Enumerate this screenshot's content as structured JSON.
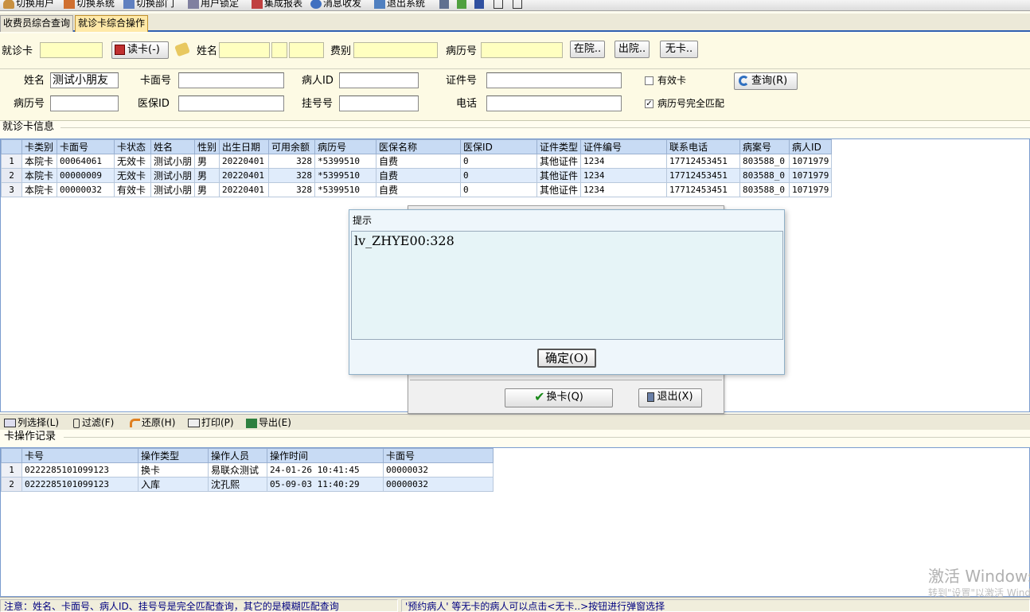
{
  "toolbar": {
    "items": [
      "切换用户",
      "切换系统",
      "切换部门",
      "用户锁定",
      "集成报表",
      "消息收发",
      "退出系统"
    ]
  },
  "tabs": [
    "收费员综合查询",
    "就诊卡综合操作"
  ],
  "top_form": {
    "card_label": "就诊卡",
    "read_card_button": "读卡(-)",
    "name_label": "姓名",
    "fee_type_label": "费别",
    "record_no_label": "病历号",
    "in_hospital_button": "在院..",
    "discharged_button": "出院..",
    "no_card_button": "无卡.."
  },
  "query_form": {
    "name_label": "姓名",
    "name_value": "测试小朋友",
    "card_face_label": "卡面号",
    "patient_id_label": "病人ID",
    "id_no_label": "证件号",
    "valid_card_label": "有效卡",
    "valid_card_checked": false,
    "query_button": "查询(R)",
    "record_no_label": "病历号",
    "insurance_id_label": "医保ID",
    "reg_no_label": "挂号号",
    "phone_label": "电话",
    "exact_match_label": "病历号完全匹配",
    "exact_match_checked": true
  },
  "card_info": {
    "title": "就诊卡信息",
    "columns": [
      "卡类别",
      "卡面号",
      "卡状态",
      "姓名",
      "性别",
      "出生日期",
      "可用余额",
      "病历号",
      "医保名称",
      "医保ID",
      "证件类型",
      "证件编号",
      "联系电话",
      "病案号",
      "病人ID"
    ],
    "rows": [
      [
        "1",
        "本院卡",
        "00064061",
        "无效卡",
        "测试小朋",
        "男",
        "20220401",
        "328",
        "*5399510",
        "自费",
        "0",
        "其他证件",
        "1234",
        "17712453451",
        "803588_0",
        "1071979"
      ],
      [
        "2",
        "本院卡",
        "00000009",
        "无效卡",
        "测试小朋",
        "男",
        "20220401",
        "328",
        "*5399510",
        "自费",
        "0",
        "其他证件",
        "1234",
        "17712453451",
        "803588_0",
        "1071979"
      ],
      [
        "3",
        "本院卡",
        "00000032",
        "有效卡",
        "测试小朋",
        "男",
        "20220401",
        "328",
        "*5399510",
        "自费",
        "0",
        "其他证件",
        "1234",
        "17712453451",
        "803588_0",
        "1071979"
      ]
    ]
  },
  "actions": [
    "列选择(L)",
    "过滤(F)",
    "还原(H)",
    "打印(P)",
    "导出(E)"
  ],
  "op_log": {
    "title": "卡操作记录",
    "columns": [
      "卡号",
      "操作类型",
      "操作人员",
      "操作时间",
      "卡面号"
    ],
    "rows": [
      [
        "1",
        "0222285101099123",
        "换卡",
        "易联众测试",
        "24-01-26 10:41:45",
        "00000032"
      ],
      [
        "2",
        "0222285101099123",
        "入库",
        "沈孔熙",
        "05-09-03 11:40:29",
        "00000032"
      ]
    ]
  },
  "back_dialog": {
    "swap_button": "换卡(Q)",
    "exit_button": "退出(X)"
  },
  "prompt_dialog": {
    "title": "提示",
    "message": "lv_ZHYE00:328",
    "ok_button": "确定(O)"
  },
  "status": {
    "left": "注意：姓名、卡面号、病人ID、挂号号是完全匹配查询，其它的是模糊匹配查询",
    "right": "'预约病人' 等无卡的病人可以点击<无卡..>按钮进行弹窗选择"
  },
  "watermark": {
    "line1": "激活 Windows",
    "line2": "转到\"设置\"以激活 Windows。"
  },
  "colors": {
    "accent": "#3060b0",
    "grid_header": "#c8dbf4",
    "input_yellow": "#ffffc0",
    "active_tab": "#ffe9a8"
  }
}
